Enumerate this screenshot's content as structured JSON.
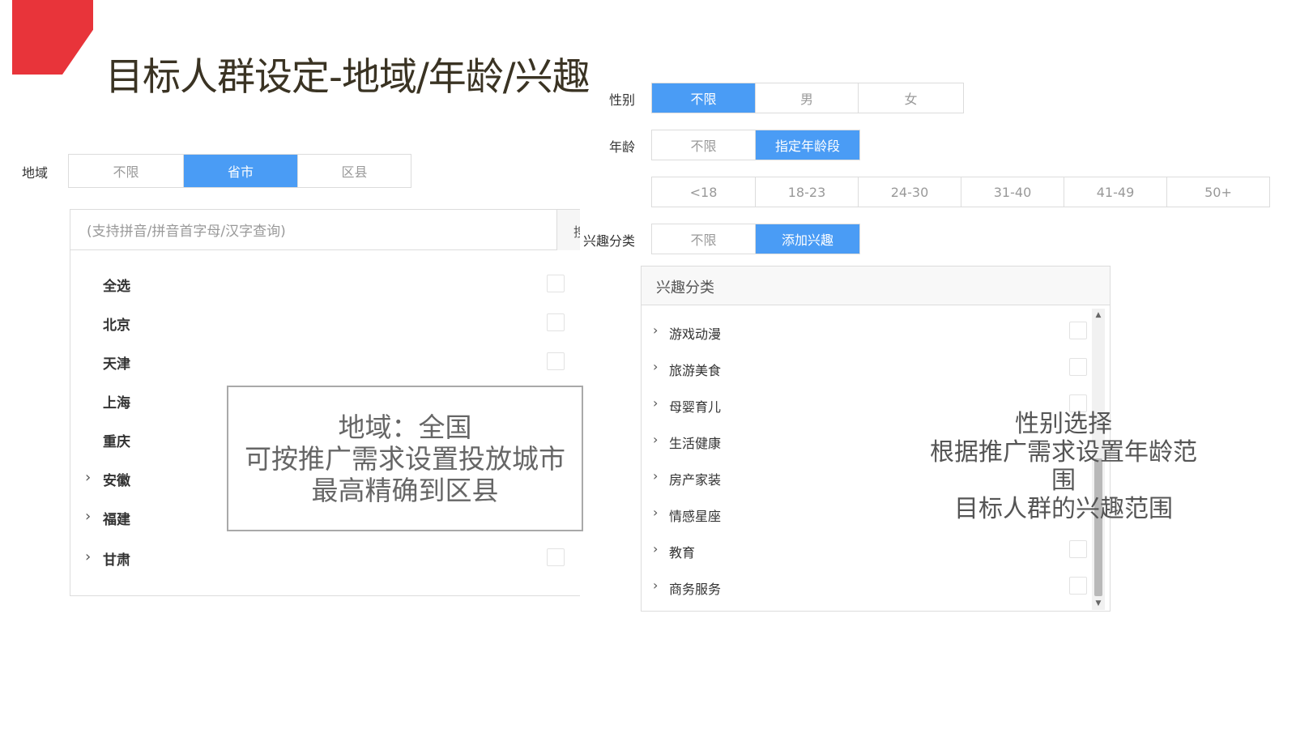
{
  "slide": {
    "title": "目标人群设定-地域/年龄/兴趣"
  },
  "region": {
    "label": "地域",
    "options": [
      "不限",
      "省市",
      "区县"
    ],
    "selected": "省市",
    "search_placeholder": "(支持拼音/拼音首字母/汉字查询)",
    "search_button": "搜",
    "items": [
      {
        "name": "全选",
        "expandable": false,
        "checkbox": true
      },
      {
        "name": "北京",
        "expandable": false,
        "checkbox": true
      },
      {
        "name": "天津",
        "expandable": false,
        "checkbox": true
      },
      {
        "name": "上海",
        "expandable": false,
        "checkbox": false
      },
      {
        "name": "重庆",
        "expandable": false,
        "checkbox": false
      },
      {
        "name": "安徽",
        "expandable": true,
        "checkbox": false
      },
      {
        "name": "福建",
        "expandable": true,
        "checkbox": false
      },
      {
        "name": "甘肃",
        "expandable": true,
        "checkbox": true
      }
    ]
  },
  "region_callout": {
    "lines": [
      "地域：全国",
      "可按推广需求设置投放城市",
      "最高精确到区县"
    ]
  },
  "gender": {
    "label": "性别",
    "options": [
      "不限",
      "男",
      "女"
    ],
    "selected": "不限"
  },
  "age": {
    "label": "年龄",
    "options": [
      "不限",
      "指定年龄段"
    ],
    "selected": "指定年龄段",
    "ranges": [
      "<18",
      "18-23",
      "24-30",
      "31-40",
      "41-49",
      "50+"
    ]
  },
  "interest": {
    "label": "兴趣分类",
    "options": [
      "不限",
      "添加兴趣"
    ],
    "selected": "添加兴趣",
    "panel_title": "兴趣分类",
    "items": [
      "游戏动漫",
      "旅游美食",
      "母婴育儿",
      "生活健康",
      "房产家装",
      "情感星座",
      "教育",
      "商务服务"
    ]
  },
  "right_callout": {
    "lines": [
      "性别选择",
      "根据推广需求设置年龄范围",
      "目标人群的兴趣范围"
    ]
  },
  "colors": {
    "accent": "#4a9cf5",
    "brand_red": "#e8343a"
  },
  "icons": {
    "chevron": "chevron-right-icon",
    "scroll_up": "scroll-up-icon",
    "scroll_down": "scroll-down-icon"
  }
}
